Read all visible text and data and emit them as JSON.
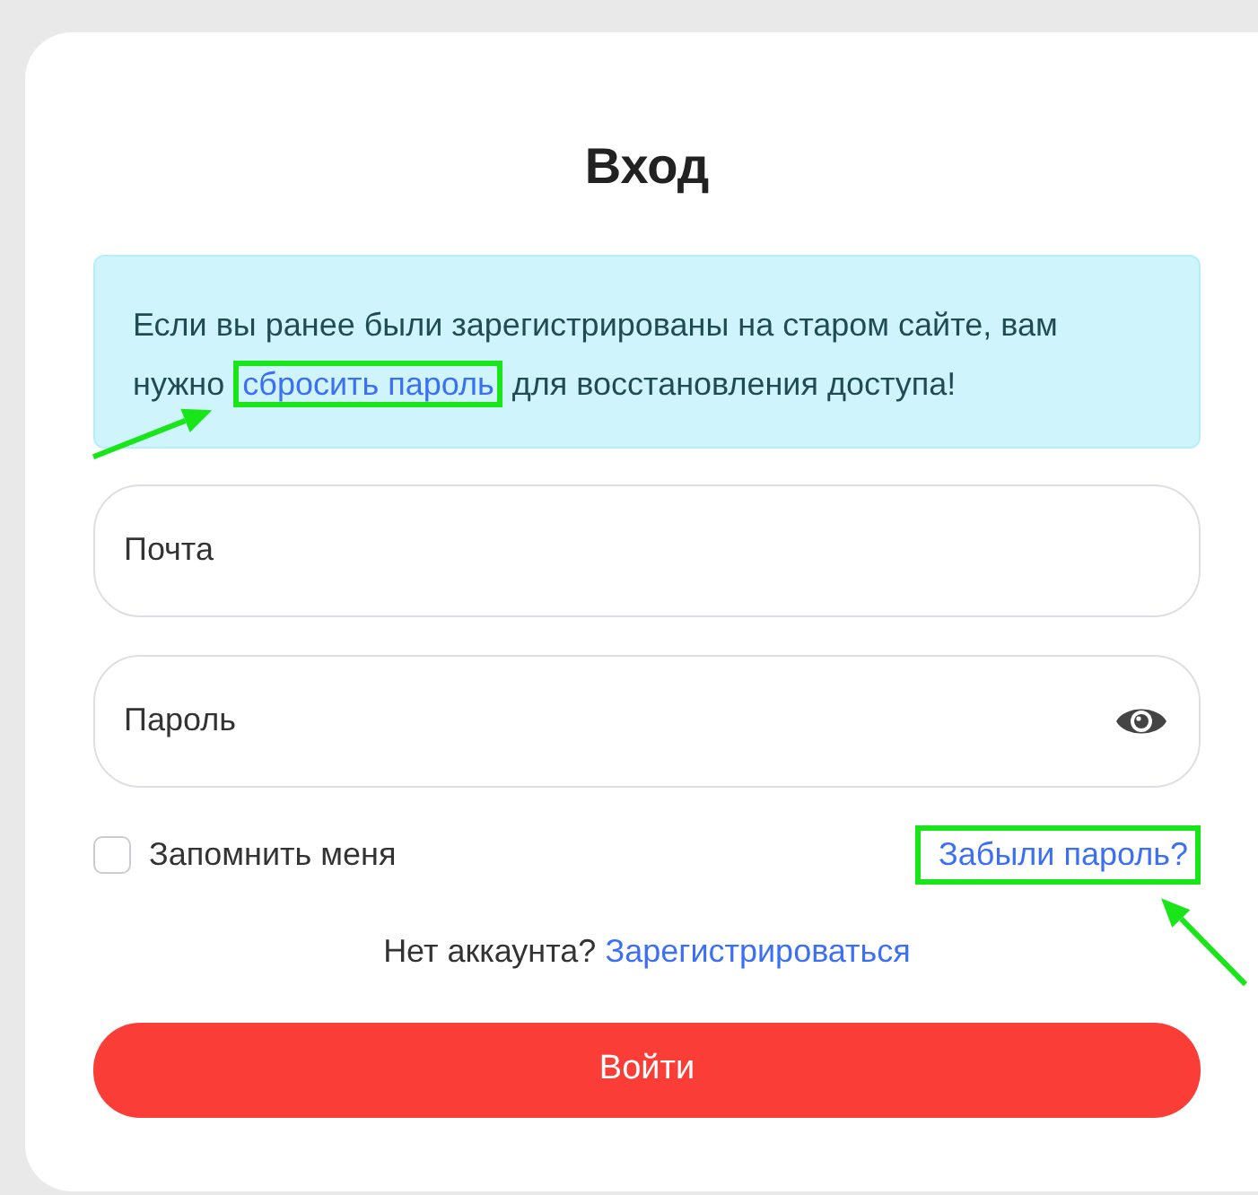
{
  "title": "Вход",
  "notice": {
    "text_before": "Если вы ранее были зарегистрированы на старом сайте, вам нужно",
    "link": {
      "label": "сбросить пароль",
      "highlighted": true,
      "arrowed": true
    },
    "text_after": "для восстановления доступа!"
  },
  "fields": [
    {
      "kind": "text",
      "placeholder": "Почта"
    },
    {
      "kind": "password",
      "placeholder": "Пароль"
    }
  ],
  "remember": {
    "label": "Запомнить меня",
    "checked": false
  },
  "forgot_link": {
    "label": "Забыли пароль?",
    "highlighted": true,
    "arrowed": true
  },
  "register": {
    "text": "Нет аккаунта?",
    "link": "Зарегистрироваться"
  },
  "submit": "Войти"
}
